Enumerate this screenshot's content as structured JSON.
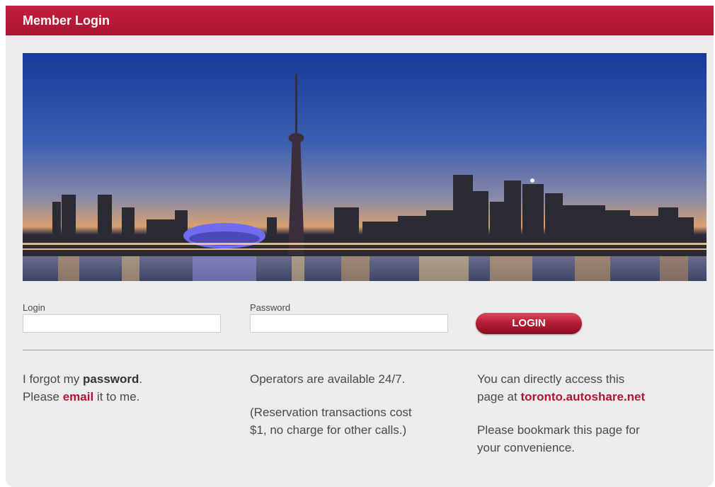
{
  "header": {
    "title": "Member Login"
  },
  "colors": {
    "brand_red": "#b01733",
    "panel_bg": "#ececec"
  },
  "banner": {
    "subject": "toronto-skyline-image"
  },
  "form": {
    "login_label": "Login",
    "login_value": "",
    "password_label": "Password",
    "password_value": "",
    "login_button": "LOGIN"
  },
  "info": {
    "forgot": {
      "line1_pre": "I forgot my ",
      "line1_bold": "password",
      "line1_post": ".",
      "line2_pre": "Please ",
      "line2_link": "email",
      "line2_post": " it to me."
    },
    "operators": {
      "line1": "Operators are available 24/7.",
      "note_line1": "(Reservation transactions cost",
      "note_line2": "$1, no charge for other calls.)"
    },
    "access": {
      "line1": "You can directly access this",
      "line2_pre": "page at ",
      "line2_link": "toronto.autoshare.net",
      "bookmark_line1": "Please bookmark this page for",
      "bookmark_line2": "your convenience."
    }
  }
}
